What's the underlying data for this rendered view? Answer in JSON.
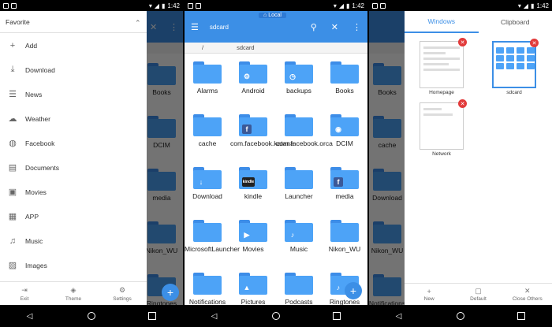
{
  "status": {
    "time": "1:42"
  },
  "drawer": {
    "title": "Favorite",
    "items": [
      {
        "label": "Add",
        "icon": "plus-icon"
      },
      {
        "label": "Download",
        "icon": "download-icon"
      },
      {
        "label": "News",
        "icon": "news-icon"
      },
      {
        "label": "Weather",
        "icon": "weather-icon"
      },
      {
        "label": "Facebook",
        "icon": "globe-icon"
      },
      {
        "label": "Documents",
        "icon": "document-icon"
      },
      {
        "label": "Movies",
        "icon": "movie-icon"
      },
      {
        "label": "APP",
        "icon": "app-icon"
      },
      {
        "label": "Music",
        "icon": "music-icon"
      },
      {
        "label": "Images",
        "icon": "image-icon"
      }
    ],
    "footer": [
      {
        "label": "Exit",
        "icon": "exit-icon"
      },
      {
        "label": "Theme",
        "icon": "theme-icon"
      },
      {
        "label": "Settings",
        "icon": "settings-icon"
      }
    ]
  },
  "background_folders_p1": {
    "col1": [
      "Books",
      "DCIM",
      "media",
      "Nikon_WU",
      "Ringtones"
    ]
  },
  "main": {
    "location": "Local",
    "title": "sdcard",
    "path": [
      "/",
      "sdcard"
    ],
    "folders": [
      {
        "label": "Alarms",
        "glyph": ""
      },
      {
        "label": "Android",
        "glyph": "⚙"
      },
      {
        "label": "backups",
        "glyph": "◷"
      },
      {
        "label": "Books",
        "glyph": ""
      },
      {
        "label": "cache",
        "glyph": ""
      },
      {
        "label": "com.facebook.katana",
        "glyph": "f"
      },
      {
        "label": "com.facebook.orca",
        "glyph": ""
      },
      {
        "label": "DCIM",
        "glyph": "◉"
      },
      {
        "label": "Download",
        "glyph": "↓"
      },
      {
        "label": "kindle",
        "glyph": "kindle"
      },
      {
        "label": "Launcher",
        "glyph": ""
      },
      {
        "label": "media",
        "glyph": "f"
      },
      {
        "label": "MicrosoftLauncher",
        "glyph": ""
      },
      {
        "label": "Movies",
        "glyph": "▶"
      },
      {
        "label": "Music",
        "glyph": "♪"
      },
      {
        "label": "Nikon_WU",
        "glyph": ""
      },
      {
        "label": "Notifications",
        "glyph": ""
      },
      {
        "label": "Pictures",
        "glyph": "▲"
      },
      {
        "label": "Podcasts",
        "glyph": ""
      },
      {
        "label": "Ringtones",
        "glyph": "♪"
      }
    ]
  },
  "windows_panel": {
    "tabs": [
      "Windows",
      "Clipboard"
    ],
    "windows": [
      "Homepage",
      "sdcard",
      "Network"
    ],
    "footer": [
      {
        "label": "New",
        "icon": "plus-icon"
      },
      {
        "label": "Default",
        "icon": "default-icon"
      },
      {
        "label": "Close Others",
        "icon": "close-icon"
      }
    ],
    "bg_folders": [
      "Books",
      "cache",
      "Download",
      "Nikon_WU",
      "Notifications"
    ]
  },
  "colors": {
    "accent": "#3c8fe6",
    "folder": "#4da3f7",
    "close": "#e23b3b"
  }
}
